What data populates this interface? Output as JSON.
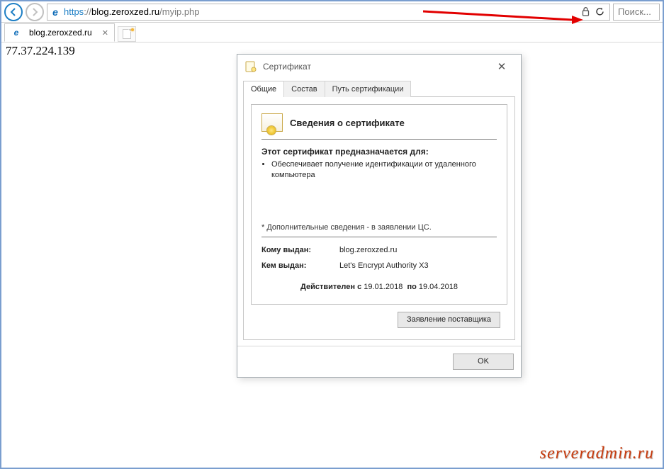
{
  "toolbar": {
    "url_scheme": "https",
    "url_sep": "://",
    "url_host": "blog.zeroxzed.ru",
    "url_path": "/myip.php",
    "search_placeholder": "Поиск..."
  },
  "tab": {
    "title": "blog.zeroxzed.ru"
  },
  "page": {
    "body_text": "77.37.224.139"
  },
  "cert_dialog": {
    "title": "Сертификат",
    "tabs": {
      "general": "Общие",
      "details": "Состав",
      "path": "Путь сертификации"
    },
    "cert_title": "Сведения о сертификате",
    "purpose_header": "Этот сертификат предназначается для:",
    "purpose_item1": "Обеспечивает получение идентификации от удаленного компьютера",
    "footnote": "* Дополнительные сведения - в заявлении ЦС.",
    "issued_to_lbl": "Кому выдан:",
    "issued_to_val": "blog.zeroxzed.ru",
    "issued_by_lbl": "Кем выдан:",
    "issued_by_val": "Let's Encrypt Authority X3",
    "valid_lbl_from": "Действителен с",
    "valid_from": "19.01.2018",
    "valid_lbl_to": "по",
    "valid_to": "19.04.2018",
    "btn_statement": "Заявление поставщика",
    "btn_ok": "OK"
  },
  "watermark": "serveradmin.ru"
}
